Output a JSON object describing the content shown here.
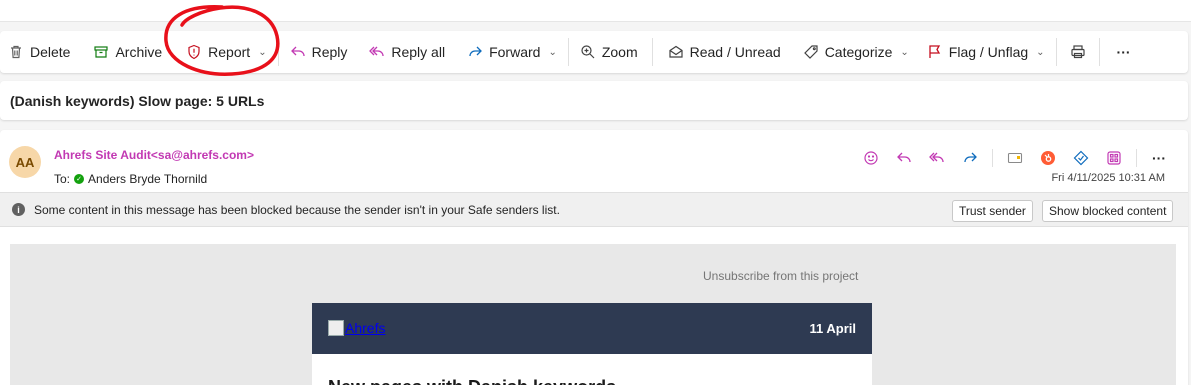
{
  "toolbar": {
    "delete": "Delete",
    "archive": "Archive",
    "report": "Report",
    "reply": "Reply",
    "reply_all": "Reply all",
    "forward": "Forward",
    "zoom": "Zoom",
    "read_unread": "Read / Unread",
    "categorize": "Categorize",
    "flag_unflag": "Flag / Unflag",
    "more": "···"
  },
  "subject": "(Danish keywords) Slow page: 5 URLs",
  "message": {
    "avatar_initials": "AA",
    "sender": "Ahrefs Site Audit<sa@ahrefs.com>",
    "to_label": "To:",
    "recipient": "Anders Bryde Thornild",
    "date": "Fri 4/11/2025 10:31 AM",
    "more": "···"
  },
  "blocked_notice": {
    "text": "Some content in this message has been blocked because the sender isn't in your Safe senders list.",
    "trust_button": "Trust sender",
    "show_button": "Show blocked content"
  },
  "email_body": {
    "unsubscribe": "Unsubscribe from this project",
    "logo_alt": "Ahrefs",
    "date": "11 April",
    "heading": "New pages with Danish keywords"
  },
  "colors": {
    "accent_purple": "#c239b3",
    "email_header_bg": "#2e3a52",
    "annotation_red": "#e8101a"
  },
  "icons": {
    "delete": "trash-icon",
    "archive": "archive-box-icon",
    "report": "shield-alert-icon",
    "reply": "reply-arrow-icon",
    "reply_all": "reply-all-arrow-icon",
    "forward": "forward-arrow-icon",
    "zoom": "zoom-in-icon",
    "read_unread": "envelope-open-icon",
    "categorize": "tag-icon",
    "flag": "flag-icon",
    "print": "printer-icon"
  }
}
